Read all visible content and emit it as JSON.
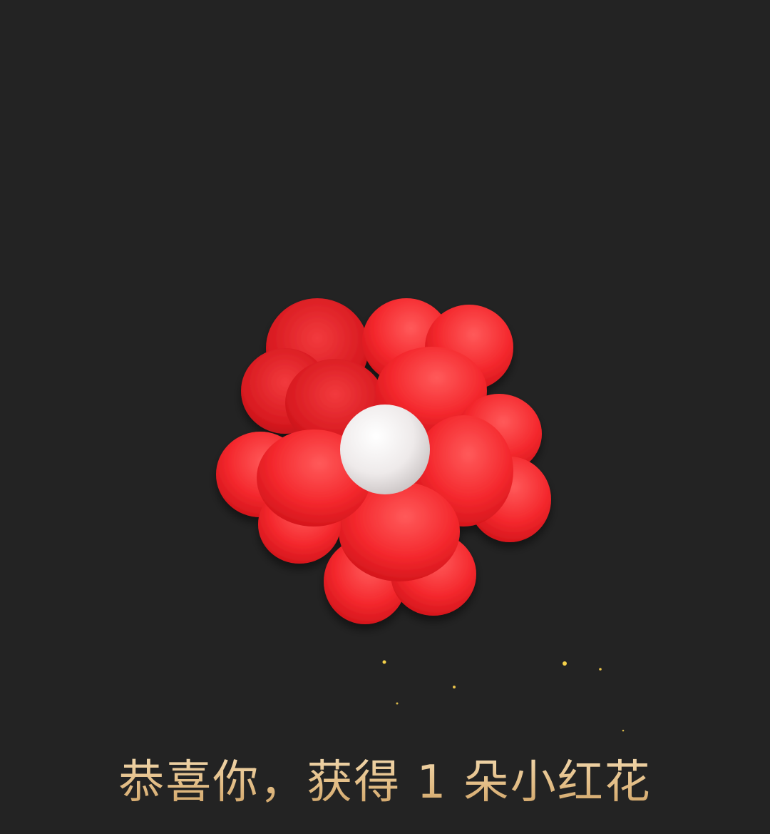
{
  "reward": {
    "message": "恭喜你，获得 1 朵小红花",
    "item_icon": "red-flower-icon"
  },
  "colors": {
    "background": "#232323",
    "petal": "#f4282d",
    "petal_highlight": "#ff4d4f",
    "center": "#f0eeee",
    "text": "#e4c08b",
    "sparkle": "#f5d24a"
  }
}
